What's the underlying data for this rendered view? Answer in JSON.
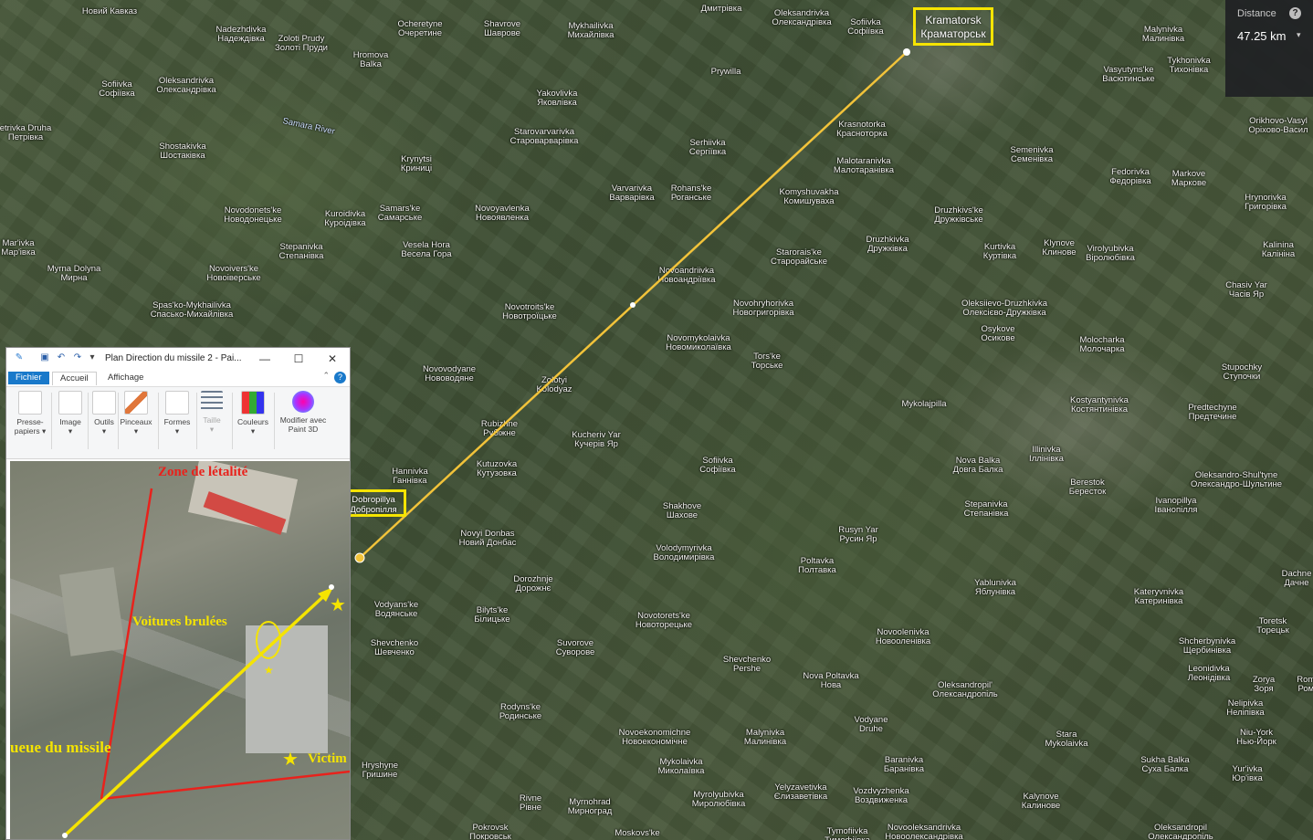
{
  "map": {
    "places": [
      {
        "name": "Новий Кавказ",
        "l1": "Новий Кавказ",
        "l2": ""
      },
      {
        "name": "Nadezhdivka",
        "l1": "Nadezhdivka",
        "l2": "Надеждівка"
      },
      {
        "name": "Zoloti Prudy",
        "l1": "Zoloti Prudy",
        "l2": "Золоті Пруди"
      },
      {
        "name": "Ocheretyne",
        "l1": "Ocheretyne",
        "l2": "Очеретине"
      },
      {
        "name": "Shavrove",
        "l1": "Shavrove",
        "l2": "Шаврове"
      },
      {
        "name": "Mykhailivka",
        "l1": "Mykhailivka",
        "l2": "Михайлівка"
      },
      {
        "name": "Dmytrivka",
        "l1": "Дмитрівка",
        "l2": ""
      },
      {
        "name": "Oleksandrivka-n",
        "l1": "Oleksandrivka",
        "l2": "Олександрівка"
      },
      {
        "name": "Sofiivka-ne",
        "l1": "Sofiivka",
        "l2": "Софіївка"
      },
      {
        "name": "Malynivka",
        "l1": "Malynivka",
        "l2": "Малинівка"
      },
      {
        "name": "Tykhonivka",
        "l1": "Tykhonivka",
        "l2": "Тихонівка"
      },
      {
        "name": "Sofiivka-w",
        "l1": "Sofiivka",
        "l2": "Софіївка"
      },
      {
        "name": "Oleksandrivka-w",
        "l1": "Oleksandrivka",
        "l2": "Олександрівка"
      },
      {
        "name": "Hromova Balka",
        "l1": "Hromova",
        "l2": "Balka"
      },
      {
        "name": "Yakovlivka",
        "l1": "Yakovlivka",
        "l2": "Яковлівка"
      },
      {
        "name": "Prywilla",
        "l1": "Prywilla",
        "l2": ""
      },
      {
        "name": "Vasyutynske",
        "l1": "Vasyutyns'ke",
        "l2": "Васютинське"
      },
      {
        "name": "Orikhovo",
        "l1": "Orikhovo-Vasyl",
        "l2": "Оріхово-Васил"
      },
      {
        "name": "Petrivka",
        "l1": "etrivka Druha",
        "l2": "Петрівка"
      },
      {
        "name": "Samara River",
        "l1": "Samara River",
        "l2": ""
      },
      {
        "name": "Starovarvarivka",
        "l1": "Starovarvarivka",
        "l2": "Старо­варварівка"
      },
      {
        "name": "Serhiivka",
        "l1": "Serhiivka",
        "l2": "Сергіївка"
      },
      {
        "name": "Krasnotorka",
        "l1": "Krasnotorka",
        "l2": "Красноторка"
      },
      {
        "name": "Semenivka",
        "l1": "Semenivka",
        "l2": "Семенівка"
      },
      {
        "name": "Shostakivka",
        "l1": "Shostakivka",
        "l2": "Шостаківка"
      },
      {
        "name": "Krynytsi",
        "l1": "Krynytsi",
        "l2": "Криниці"
      },
      {
        "name": "Malotaranivka",
        "l1": "Malotaranivka",
        "l2": "Малотаранівка"
      },
      {
        "name": "Fedorivka",
        "l1": "Fedorivka",
        "l2": "Федорівка"
      },
      {
        "name": "Markove",
        "l1": "Markove",
        "l2": "Маркове"
      },
      {
        "name": "Hrynorivka",
        "l1": "Hrynorivka",
        "l2": "Григорівка"
      },
      {
        "name": "Varvarivka",
        "l1": "Varvarivka",
        "l2": "Варварівка"
      },
      {
        "name": "Rohanske",
        "l1": "Rohans'ke",
        "l2": "Роганське"
      },
      {
        "name": "Komyshuvakha",
        "l1": "Komyshuvakha",
        "l2": "Комишуваха"
      },
      {
        "name": "Novodonetske",
        "l1": "Novodonets'ke",
        "l2": "Новодонецьке"
      },
      {
        "name": "Kuroidivka",
        "l1": "Kuroidivka",
        "l2": "Куроідівка"
      },
      {
        "name": "Samarske",
        "l1": "Samars'ke",
        "l2": "Самарське"
      },
      {
        "name": "Novoyavlenka",
        "l1": "Novoyavlenka",
        "l2": "Новоявленка"
      },
      {
        "name": "Druzhkivske",
        "l1": "Druzhkivs'ke",
        "l2": "Дружківське"
      },
      {
        "name": "Marivka",
        "l1": "Mar'ivka",
        "l2": "Мар'івка"
      },
      {
        "name": "Stepanivka-w",
        "l1": "Stepanivka",
        "l2": "Степанівка"
      },
      {
        "name": "Vesela Hora",
        "l1": "Vesela Hora",
        "l2": "Весела Гора"
      },
      {
        "name": "Druzhkivka",
        "l1": "Druzhkivka",
        "l2": "Дружківка"
      },
      {
        "name": "Kurtivka",
        "l1": "Kurtivka",
        "l2": "Куртівка"
      },
      {
        "name": "Klynove",
        "l1": "Klynove",
        "l2": "Клинове"
      },
      {
        "name": "Virolyubivka",
        "l1": "Virolyubivka",
        "l2": "Віролюбівка"
      },
      {
        "name": "Kalinina",
        "l1": "Kalinina",
        "l2": "Калініна"
      },
      {
        "name": "Myrna Dolyna",
        "l1": "Myrna Dolyna",
        "l2": "Мирна"
      },
      {
        "name": "Novoiverske",
        "l1": "Novoivers'ke",
        "l2": "Новоіверське"
      },
      {
        "name": "Novoandriivka",
        "l1": "Novoandriivka",
        "l2": "Новоандріївка"
      },
      {
        "name": "Staroraiske",
        "l1": "Starorais'ke",
        "l2": "Старорайське"
      },
      {
        "name": "Chasiv Yar",
        "l1": "Chasiv Yar",
        "l2": "Часів Яр"
      },
      {
        "name": "Spaske",
        "l1": "Spas'ko-Mykhailivka",
        "l2": "Спасько-Михайлівка"
      },
      {
        "name": "Novotroitske",
        "l1": "Novotroits'ke",
        "l2": "Новотроїцьке"
      },
      {
        "name": "Novohryhorivka",
        "l1": "Novohryhorivka",
        "l2": "Новогригорівка"
      },
      {
        "name": "Oleksiievo",
        "l1": "Oleksiievo-Druzhkivka",
        "l2": "Олексієво-Дружківка"
      },
      {
        "name": "Osykove",
        "l1": "Osykove",
        "l2": "Осикове"
      },
      {
        "name": "Novomykolaivka",
        "l1": "Novomykolaivka",
        "l2": "Новомиколаївка"
      },
      {
        "name": "Molocharka",
        "l1": "Molocharka",
        "l2": "Молочарка"
      },
      {
        "name": "Torske",
        "l1": "Tors'ke",
        "l2": "Торське"
      },
      {
        "name": "Stupochky",
        "l1": "Stupochky",
        "l2": "Ступочки"
      },
      {
        "name": "Novovodyane",
        "l1": "Novovodyane",
        "l2": "Нововодяне"
      },
      {
        "name": "Zolotyi Kolodyaz",
        "l1": "Zolotyi",
        "l2": "Kolodyaz"
      },
      {
        "name": "Mykolaipilla",
        "l1": "Mykolajpilla",
        "l2": ""
      },
      {
        "name": "Kostyantynivka",
        "l1": "Kostyantynivka",
        "l2": "Костянтинівка"
      },
      {
        "name": "Predtechyne",
        "l1": "Predtechyne",
        "l2": "Предтечине"
      },
      {
        "name": "Rubizhne",
        "l1": "Rubizhne",
        "l2": "Рубіжне"
      },
      {
        "name": "Kucheriv Yar",
        "l1": "Kucheriv Yar",
        "l2": "Кучерів Яр"
      },
      {
        "name": "Nova Balka",
        "l1": "Nova Balka",
        "l2": "Довга Балка"
      },
      {
        "name": "Illinivka",
        "l1": "Illinivka",
        "l2": "Іллінівка"
      },
      {
        "name": "Hannivka",
        "l1": "Hannivka",
        "l2": "Ганнівка"
      },
      {
        "name": "Kutuzovka",
        "l1": "Kutuzovka",
        "l2": "Кутузовка"
      },
      {
        "name": "Sofiivka-c",
        "l1": "Sofiivka",
        "l2": "Софіївка"
      },
      {
        "name": "Berestok",
        "l1": "Berestok",
        "l2": "Бересток"
      },
      {
        "name": "Oleksandro-Shultyne",
        "l1": "Oleksandro-Shul'tyne",
        "l2": "Олександро-Шультине"
      },
      {
        "name": "Stepanivka-e",
        "l1": "Stepanivka",
        "l2": "Степанівка"
      },
      {
        "name": "Ivanopillya",
        "l1": "Ivanopillya",
        "l2": "Іванопілля"
      },
      {
        "name": "Shakhove",
        "l1": "Shakhove",
        "l2": "Шахове"
      },
      {
        "name": "Novyi Donbas",
        "l1": "Novyi Donbas",
        "l2": "Новий Донбас"
      },
      {
        "name": "Rusyn Yar",
        "l1": "Rusyn Yar",
        "l2": "Русин Яр"
      },
      {
        "name": "Volodymyrivka",
        "l1": "Volodymyrivka",
        "l2": "Володимирівка"
      },
      {
        "name": "Poltavka",
        "l1": "Poltavka",
        "l2": "Полтавка"
      },
      {
        "name": "Dorozhnje",
        "l1": "Dorozhnje",
        "l2": "Дорожнє"
      },
      {
        "name": "Yablunivka",
        "l1": "Yablunivka",
        "l2": "Яблунівка"
      },
      {
        "name": "Kateryvnivka",
        "l1": "Kateryvnivka",
        "l2": "Катеринівка"
      },
      {
        "name": "Dachne",
        "l1": "Dachne",
        "l2": "Дачне"
      },
      {
        "name": "Vodyanske",
        "l1": "Vodyans'ke",
        "l2": "Водянське"
      },
      {
        "name": "Biltske",
        "l1": "Bilyts'ke",
        "l2": "Білицьке"
      },
      {
        "name": "Novotoretske",
        "l1": "Novotorets'ke",
        "l2": "Новоторецьке"
      },
      {
        "name": "Toretsk",
        "l1": "Toretsk",
        "l2": "Торецьк"
      },
      {
        "name": "Novoolenivka",
        "l1": "Novoolenivka",
        "l2": "Новооленівка"
      },
      {
        "name": "Shcherbynivka",
        "l1": "Shcherbynivka",
        "l2": "Щербинівка"
      },
      {
        "name": "Shevchenko",
        "l1": "Shevchenko",
        "l2": "Шевченко"
      },
      {
        "name": "Suvorove",
        "l1": "Suvorove",
        "l2": "Суворове"
      },
      {
        "name": "Leonidivka",
        "l1": "Leonidivka",
        "l2": "Леонідівка"
      },
      {
        "name": "Shevchenko Pershe",
        "l1": "Shevchenko",
        "l2": "Pershe"
      },
      {
        "name": "Nova Poltavka",
        "l1": "Nova Poltavka",
        "l2": "Нова"
      },
      {
        "name": "Oleksandropil",
        "l1": "Oleksandropil'",
        "l2": "Олександропіль"
      },
      {
        "name": "Zorya",
        "l1": "Zorya",
        "l2": "Зоря"
      },
      {
        "name": "Romanivka",
        "l1": "Romanivka",
        "l2": "Романівка"
      },
      {
        "name": "Nelipivka",
        "l1": "Nelipivka",
        "l2": "Неліпівка"
      },
      {
        "name": "Rodynske",
        "l1": "Rodyns'ke",
        "l2": "Родинське"
      },
      {
        "name": "Vodyane",
        "l1": "Vodyane",
        "l2": "Druhe"
      },
      {
        "name": "Niu-York",
        "l1": "Niu-York",
        "l2": "Нью-Йорк"
      },
      {
        "name": "Novoekonomichne",
        "l1": "Novoekonomichne",
        "l2": "Новоекономічне"
      },
      {
        "name": "Malynivka-s",
        "l1": "Malynivka",
        "l2": "Малинівка"
      },
      {
        "name": "Baranivka",
        "l1": "Baranivka",
        "l2": "Баранівка"
      },
      {
        "name": "Stara Mykolaivka",
        "l1": "Stara",
        "l2": "Mykolaivka"
      },
      {
        "name": "Sukha Balka",
        "l1": "Sukha Balka",
        "l2": "Суха Балка"
      },
      {
        "name": "Yurivka",
        "l1": "Yur'ivka",
        "l2": "Юр'івка"
      },
      {
        "name": "Mykolaivka-s",
        "l1": "Mykolaivka",
        "l2": "Миколаївка"
      },
      {
        "name": "Hryshyne",
        "l1": "Hryshyne",
        "l2": "Гришине"
      },
      {
        "name": "Yelyzavetivka",
        "l1": "Yelyzavetivka",
        "l2": "Єлизаветівка"
      },
      {
        "name": "Vozdvyzhenka",
        "l1": "Vozdvyzhenka",
        "l2": "Воздвиженка"
      },
      {
        "name": "Myrolyubivka",
        "l1": "Myrolyubivka",
        "l2": "Миролюбівка"
      },
      {
        "name": "Kalynove",
        "l1": "Kalynove",
        "l2": "Калинове"
      },
      {
        "name": "Rivne",
        "l1": "Rivne",
        "l2": "Рівне"
      },
      {
        "name": "Myrnohrad",
        "l1": "Myrnohrad",
        "l2": "Мирноград"
      },
      {
        "name": "Pokrovsk",
        "l1": "Pokrovsk",
        "l2": "Покровськ"
      },
      {
        "name": "Moskovske",
        "l1": "Moskovs'ke",
        "l2": ""
      },
      {
        "name": "Tymofiivka",
        "l1": "Tymofiivka",
        "l2": "Тимофіївка"
      },
      {
        "name": "Novooleksandrivka",
        "l1": "Novooleksandrivka",
        "l2": "Новоолександрівка"
      },
      {
        "name": "Oleksandropil-s",
        "l1": "Oleksandropil",
        "l2": "Олександропіль"
      }
    ],
    "highlight_kramatorsk": {
      "l1": "Kramatorsk",
      "l2": "Краматорськ"
    },
    "highlight_dobropillya": {
      "l1": "Dobropillya",
      "l2": "Добропілля"
    },
    "route_color": "#f2c33a",
    "highlight_color": "#f5e400"
  },
  "distance_panel": {
    "label": "Distance",
    "help": "?",
    "value": "47.25 km",
    "caret": "▾"
  },
  "paint": {
    "title": "Plan  Direction du missile 2 - Pai...",
    "min": "—",
    "max": "☐",
    "close": "✕",
    "tabs": {
      "fichier": "Fichier",
      "accueil": "Accueil",
      "affichage": "Affichage"
    },
    "help": "?",
    "tools": [
      {
        "name": "presse-papiers",
        "l1": "Presse-",
        "l2": "papiers ▾"
      },
      {
        "name": "image",
        "l1": "Image",
        "l2": "▾"
      },
      {
        "name": "outils",
        "l1": "Outils",
        "l2": "▾"
      },
      {
        "name": "pinceaux",
        "l1": "Pinceaux",
        "l2": "▾"
      },
      {
        "name": "formes",
        "l1": "Formes",
        "l2": "▾"
      },
      {
        "name": "taille",
        "l1": "Taille",
        "l2": "▾"
      },
      {
        "name": "couleurs",
        "l1": "Couleurs",
        "l2": "▾"
      },
      {
        "name": "modifier",
        "l1": "Modifier avec",
        "l2": "Paint 3D"
      }
    ],
    "labels": {
      "zone": "Zone de létalité",
      "voitures": "Voitures brulées",
      "queue": "ueue du missile",
      "victimes": "Victim"
    },
    "colors": {
      "red": "#e8221c",
      "yellow": "#f5e400"
    }
  }
}
